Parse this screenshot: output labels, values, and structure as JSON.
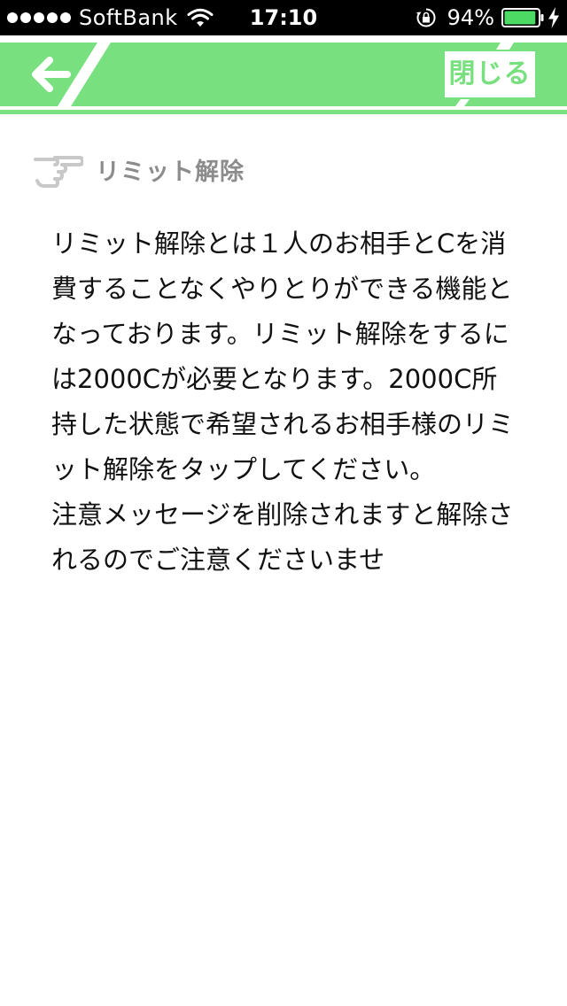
{
  "status_bar": {
    "carrier": "SoftBank",
    "time": "17:10",
    "battery_percent": "94%",
    "battery_level": 0.94,
    "signal_bars": 5
  },
  "header": {
    "close_label": "閉じる",
    "back_icon": "arrow-left-icon",
    "accent_color": "#78e07e"
  },
  "section": {
    "title": "リミット解除",
    "icon": "pointing-hand-icon"
  },
  "body": {
    "text": "リミット解除とは１人のお相手とCを消費することなくやりとりができる機能となっております。リミット解除をするには2000Cが必要となります。2000C所持した状態で希望されるお相手様のリミット解除をタップしてください。\n注意メッセージを削除されますと解除されるのでご注意くださいませ"
  }
}
